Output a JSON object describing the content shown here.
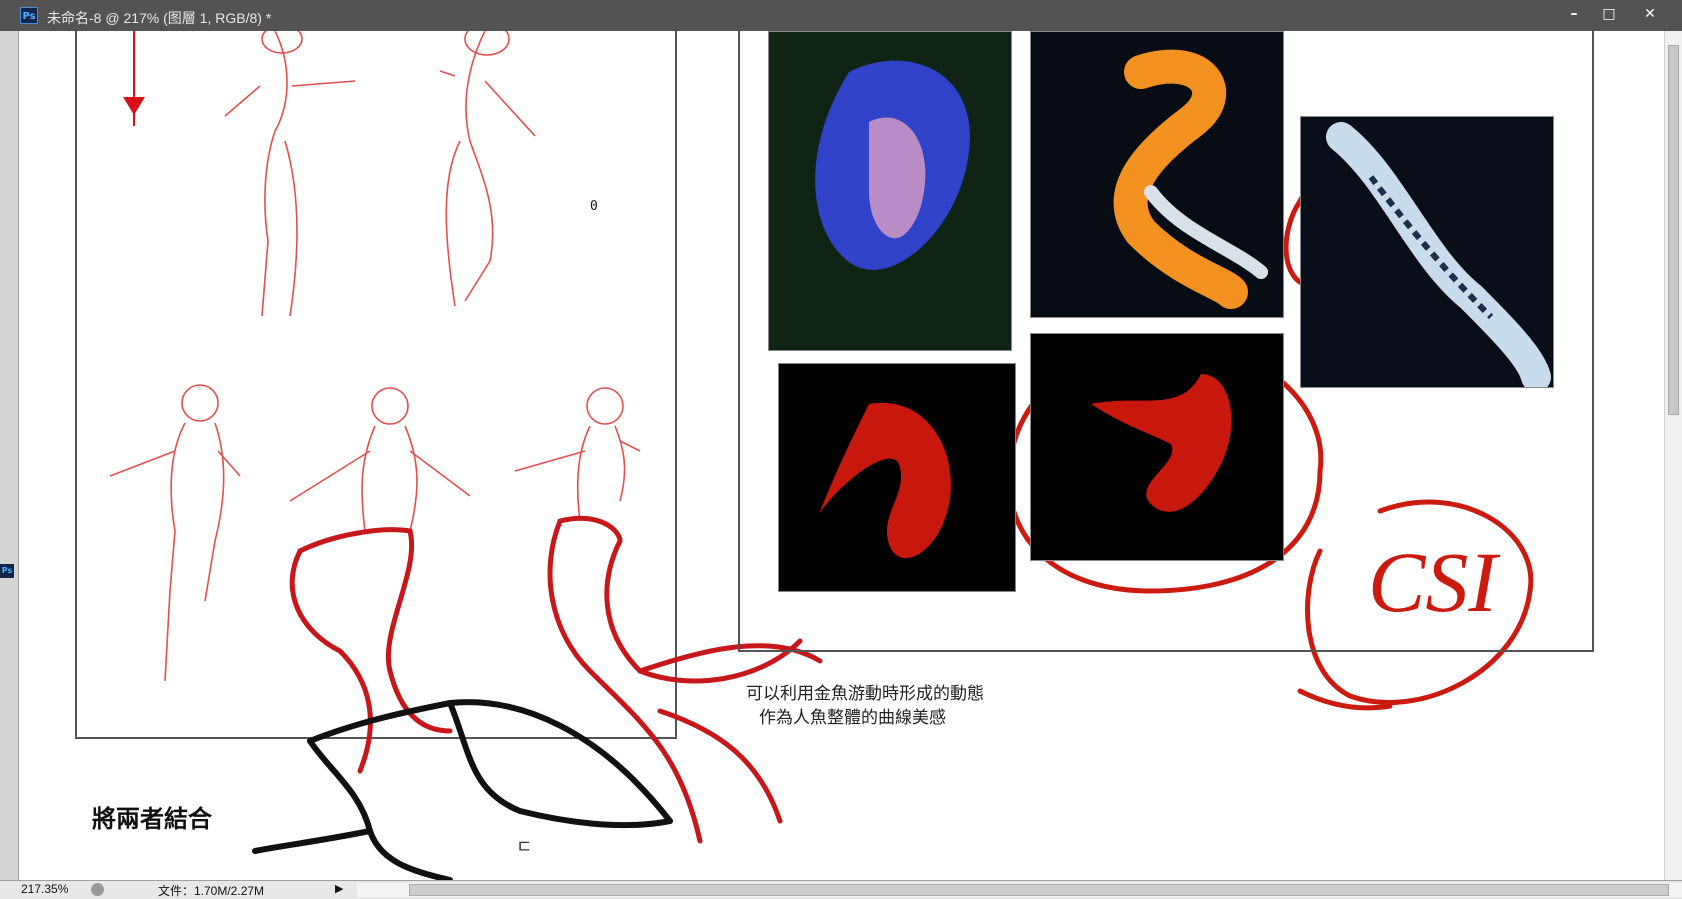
{
  "window": {
    "app_icon": "Ps",
    "title": "未命名-8 @ 217% (图層 1, RGB/8) *",
    "buttons": {
      "minimize": "–",
      "maximize": "□",
      "close": "✕"
    }
  },
  "left_panel": {
    "icon": "Ps"
  },
  "canvas": {
    "reference_photos": [
      "blue-betta",
      "orange-koi",
      "white-koi",
      "red-betta-1",
      "red-betta-2"
    ],
    "caption_line1": "可以利用金魚游動時形成的動態",
    "caption_line2": "作為人魚整體的曲線美感",
    "heading": "將兩者結合",
    "cursor_glyph": "0",
    "small_mark": "ㄷ",
    "annotation_text": "CSI",
    "annotation_color": "#cc1a10"
  },
  "status_bar": {
    "zoom": "217.35%",
    "doc_size": "文件：1.70M/2.27M",
    "arrow": "▶"
  }
}
